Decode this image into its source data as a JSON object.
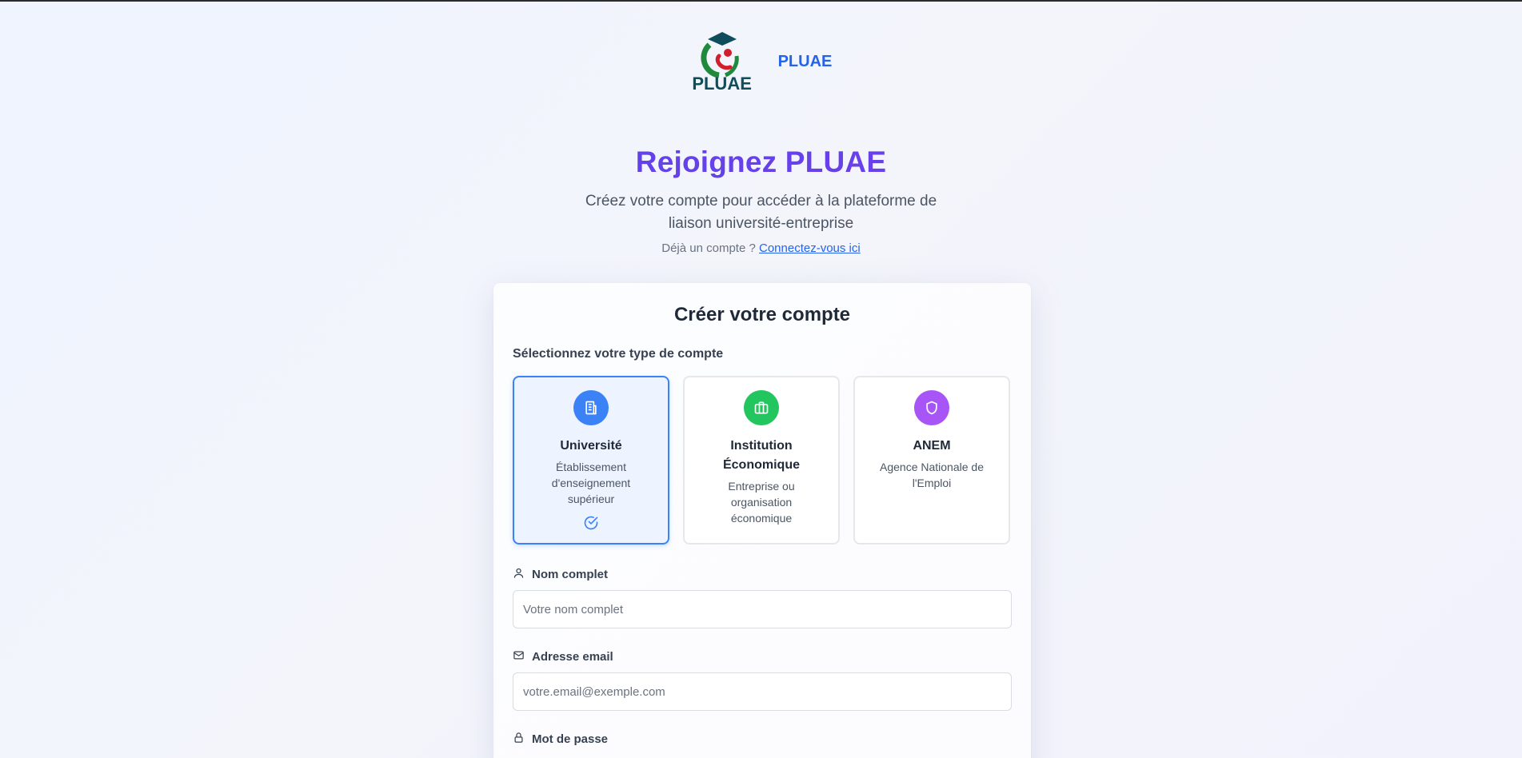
{
  "brand": {
    "logo_text": "PLUAE",
    "name": "PLUAE"
  },
  "hero": {
    "title": "Rejoignez PLUAE",
    "subtitle": "Créez votre compte pour accéder à la plateforme de liaison université-entreprise",
    "login_prompt": "Déjà un compte ?",
    "login_link": "Connectez-vous ici"
  },
  "form": {
    "title": "Créer votre compte",
    "type_label": "Sélectionnez votre type de compte",
    "account_types": [
      {
        "name": "Université",
        "description": "Établissement d'enseignement supérieur",
        "selected": true,
        "icon": "building-icon",
        "color": "#3b82f6"
      },
      {
        "name": "Institution Économique",
        "description": "Entreprise ou organisation économique",
        "selected": false,
        "icon": "briefcase-icon",
        "color": "#22c55e"
      },
      {
        "name": "ANEM",
        "description": "Agence Nationale de l'Emploi",
        "selected": false,
        "icon": "shield-icon",
        "color": "#a855f7"
      }
    ],
    "fields": {
      "name": {
        "label": "Nom complet",
        "value": "",
        "placeholder": "Votre nom complet"
      },
      "email": {
        "label": "Adresse email",
        "value": "",
        "placeholder": "votre.email@exemple.com"
      },
      "password": {
        "label": "Mot de passe"
      }
    }
  },
  "colors": {
    "accent": "#2563eb",
    "title_gradient_start": "#5048e5",
    "title_gradient_end": "#7c3aed"
  }
}
